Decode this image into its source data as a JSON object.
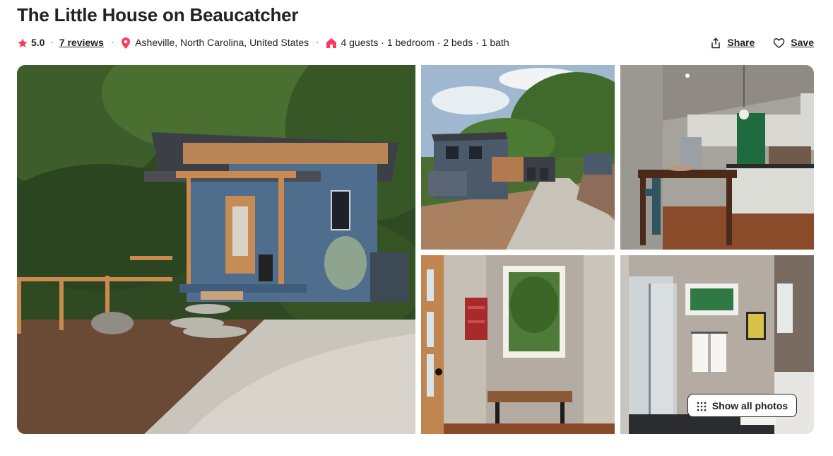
{
  "listing": {
    "title": "The Little House on Beaucatcher",
    "rating": "5.0",
    "reviews_label": "7 reviews",
    "location": "Asheville, North Carolina, United States",
    "details": "4 guests · 1 bedroom · 2 beds · 1 bath"
  },
  "actions": {
    "share_label": "Share",
    "save_label": "Save"
  },
  "gallery": {
    "show_all_label": "Show all photos",
    "photos": [
      {
        "subject": "exterior-front"
      },
      {
        "subject": "exterior-driveway"
      },
      {
        "subject": "kitchen"
      },
      {
        "subject": "entry-bench"
      },
      {
        "subject": "bathroom"
      }
    ]
  },
  "icons": {
    "star": "star-icon",
    "location": "location-pin-icon",
    "home": "home-icon",
    "share": "share-icon",
    "save": "heart-icon",
    "grid": "grid-dots-icon"
  },
  "colors": {
    "accent": "#FF385C",
    "text": "#222222"
  }
}
